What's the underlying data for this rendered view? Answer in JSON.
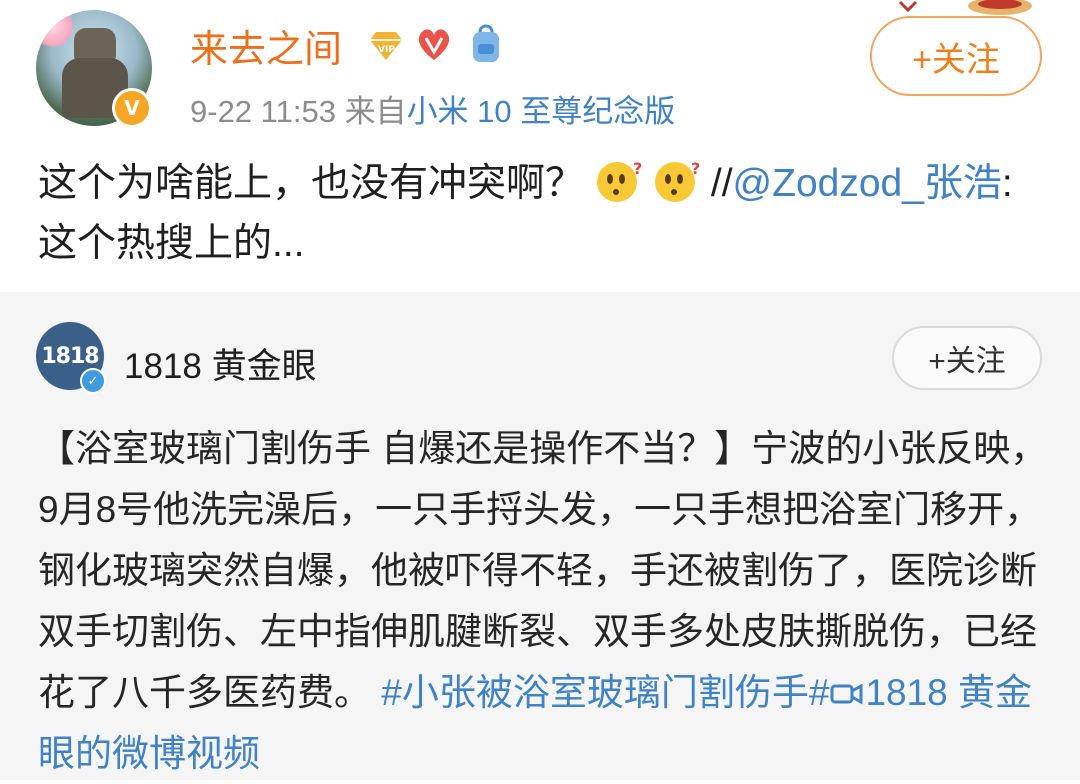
{
  "post": {
    "username": "来去之间",
    "badges": [
      "vip-badge-icon",
      "heart-badge-icon",
      "backpack-badge-icon"
    ],
    "time": "9-22 11:53",
    "source_prefix": "来自",
    "device": "小米 10 至尊纪念版",
    "follow_label": "+关注",
    "verified_mark": "V",
    "content": {
      "text_before": "这个为啥能上，也没有冲突啊？",
      "emojis": [
        "thinking-face-icon",
        "thinking-face-icon"
      ],
      "separator": "//",
      "mention": "@Zodzod_张浩",
      "text_after": ":这个热搜上的..."
    }
  },
  "repost": {
    "author": "1818 黄金眼",
    "avatar_text": "1818",
    "verified_mark": "✓",
    "follow_label": "+关注",
    "text": "【浴室玻璃门割伤手 自爆还是操作不当？】宁波的小张反映，9月8号他洗完澡后，一只手捋头发，一只手想把浴室门移开，钢化玻璃突然自爆，他被吓得不轻，手还被割伤了，医院诊断双手切割伤、左中指伸肌腱断裂、双手多处皮肤撕脱伤，已经花了八千多医药费。",
    "hashtag": "#小张被浴室玻璃门割伤手#",
    "video_link": "1818 黄金眼的微博视频"
  },
  "colors": {
    "username": "#f06e1a",
    "link": "#3f82c6",
    "meta": "#8c8c8c",
    "follow_border": "#f7a35c",
    "repost_bg": "#f5f5f5"
  }
}
